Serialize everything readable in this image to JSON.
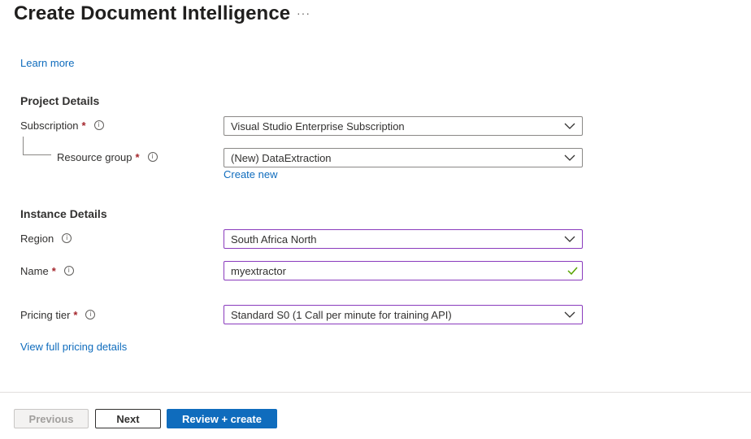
{
  "header": {
    "title": "Create Document Intelligence",
    "more_label": "···"
  },
  "links": {
    "learn_more": "Learn more",
    "create_new": "Create new",
    "view_pricing": "View full pricing details"
  },
  "project_details": {
    "heading": "Project Details",
    "subscription": {
      "label": "Subscription",
      "value": "Visual Studio Enterprise Subscription"
    },
    "resource_group": {
      "label": "Resource group",
      "value": "(New) DataExtraction"
    }
  },
  "instance_details": {
    "heading": "Instance Details",
    "region": {
      "label": "Region",
      "value": "South Africa North"
    },
    "name": {
      "label": "Name",
      "value": "myextractor"
    },
    "pricing_tier": {
      "label": "Pricing tier",
      "value": "Standard S0 (1 Call per minute for training API)"
    }
  },
  "required_marker": "*",
  "info_glyph": "i",
  "footer": {
    "previous": "Previous",
    "next": "Next",
    "review_create": "Review + create"
  },
  "colors": {
    "link": "#0f6cbd",
    "primary": "#0f6cbd",
    "required": "#a4262c",
    "active_border": "#8a3bbd",
    "valid_check": "#57a300"
  },
  "icons": {
    "dropdown": "chevron-down-icon",
    "info": "info-icon",
    "valid": "checkmark-icon"
  }
}
